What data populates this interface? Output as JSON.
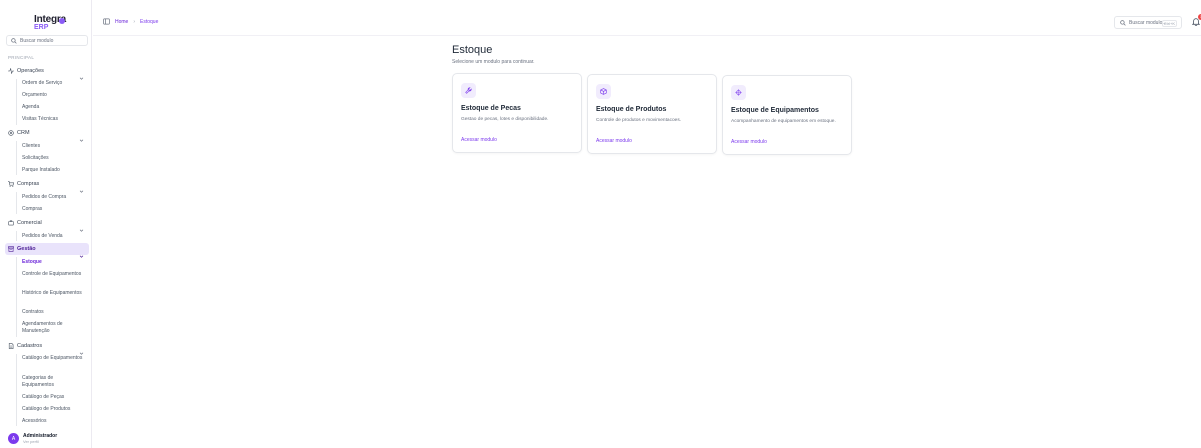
{
  "app": {
    "logo_line1": "Integra",
    "logo_line2": "ERP"
  },
  "sidebar": {
    "search_placeholder": "Buscar modulo",
    "section_label": "PRINCIPAL",
    "groups": [
      {
        "label": "Operações",
        "icon": "activity-icon",
        "items": [
          "Ordem de Serviço",
          "Orçamento",
          "Agenda",
          "Visitas Técnicas"
        ]
      },
      {
        "label": "CRM",
        "icon": "target-icon",
        "items": [
          "Clientes",
          "Solicitações",
          "Parque Instalado"
        ]
      },
      {
        "label": "Compras",
        "icon": "cart-icon",
        "items": [
          "Pedidos de Compra",
          "Compras"
        ]
      },
      {
        "label": "Comercial",
        "icon": "briefcase-icon",
        "items": [
          "Pedidos de Venda"
        ]
      },
      {
        "label": "Gestão",
        "icon": "archive-icon",
        "active": true,
        "items": [
          "Estoque",
          "Controle de Equipamentos",
          "Histórico de Equipamentos",
          "Contratos",
          "Agendamentos de Manutenção"
        ]
      },
      {
        "label": "Cadastros",
        "icon": "file-icon",
        "items": [
          "Catálogo de Equipamentos",
          "Categorias de Equipamentos",
          "Catálogo de Peças",
          "Catálogo de Produtos",
          "Acessórios"
        ]
      }
    ],
    "user": {
      "initial": "A",
      "name": "Administrador",
      "sub": "Ver perfil"
    }
  },
  "topbar": {
    "breadcrumb": [
      "Home",
      "Estoque"
    ],
    "search_placeholder": "Buscar modulo...",
    "search_shortcut": "Ctrl+K",
    "notification_count": "1"
  },
  "main": {
    "title": "Estoque",
    "subtitle": "Selecione um modulo para continuar.",
    "cards": [
      {
        "title": "Estoque de Pecas",
        "description": "Gestao de pecas, lotes e disponibilidade.",
        "link": "Acessar modulo",
        "icon": "wrench-icon"
      },
      {
        "title": "Estoque de Produtos",
        "description": "Controle de produtos e movimentacoes.",
        "link": "Acessar modulo",
        "icon": "package-icon"
      },
      {
        "title": "Estoque de Equipamentos",
        "description": "Acompanhamento de equipamentos em estoque.",
        "link": "Acessar modulo",
        "icon": "gear-icon"
      }
    ]
  },
  "colors": {
    "accent": "#7c3aed",
    "active_bg": "#e9e3fb",
    "badge": "#ef4444"
  }
}
